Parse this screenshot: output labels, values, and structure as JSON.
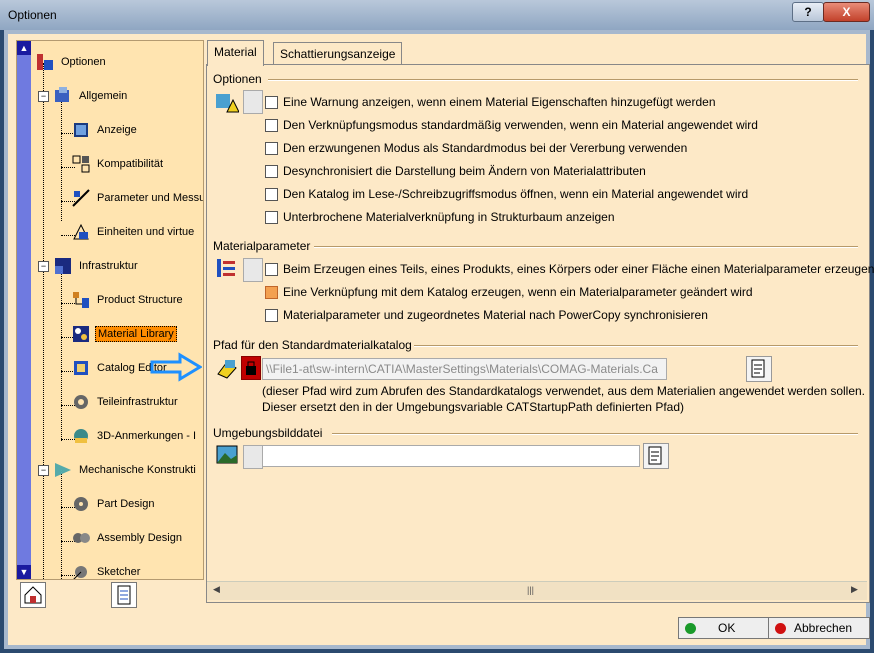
{
  "window": {
    "title": "Optionen",
    "help_label": "?",
    "close_label": "X"
  },
  "tree": {
    "items": [
      {
        "label": "Optionen",
        "icon": "options-icon"
      },
      {
        "label": "Allgemein",
        "icon": "general-icon"
      },
      {
        "label": "Anzeige",
        "icon": "display-icon"
      },
      {
        "label": "Kompatibilität",
        "icon": "compatibility-icon"
      },
      {
        "label": "Parameter und Messu",
        "icon": "parameters-icon"
      },
      {
        "label": "Einheiten und virtue",
        "icon": "units-icon"
      },
      {
        "label": "Infrastruktur",
        "icon": "infrastructure-icon"
      },
      {
        "label": "Product Structure",
        "icon": "product-structure-icon"
      },
      {
        "label": "Material Library",
        "icon": "material-library-icon"
      },
      {
        "label": "Catalog Editor",
        "icon": "catalog-editor-icon"
      },
      {
        "label": "Teileinfrastruktur",
        "icon": "gear-icon"
      },
      {
        "label": "3D-Anmerkungen - I",
        "icon": "annotation-icon"
      },
      {
        "label": "Mechanische Konstrukti",
        "icon": "mechanical-icon"
      },
      {
        "label": "Part Design",
        "icon": "part-design-icon"
      },
      {
        "label": "Assembly Design",
        "icon": "assembly-icon"
      },
      {
        "label": "Sketcher",
        "icon": "sketcher-icon"
      }
    ],
    "selected": "Material Library"
  },
  "tabs": [
    {
      "label": "Material",
      "active": true
    },
    {
      "label": "Schattierungsanzeige",
      "active": false
    }
  ],
  "options": {
    "title": "Optionen",
    "items": [
      {
        "label": "Eine Warnung anzeigen, wenn einem Material Eigenschaften hinzugefügt werden",
        "checked": false
      },
      {
        "label": "Den Verknüpfungsmodus standardmäßig verwenden, wenn ein Material angewendet wird",
        "checked": false
      },
      {
        "label": "Den erzwungenen Modus als Standardmodus bei der Vererbung verwenden",
        "checked": false
      },
      {
        "label": "Desynchronisiert die Darstellung beim Ändern von Materialattributen",
        "checked": false
      },
      {
        "label": "Den Katalog im Lese-/Schreibzugriffsmodus öffnen, wenn ein Material angewendet wird",
        "checked": false
      },
      {
        "label": "Unterbrochene Materialverknüpfung in Strukturbaum anzeigen",
        "checked": false
      }
    ]
  },
  "materialparameter": {
    "title": "Materialparameter",
    "items": [
      {
        "label": "Beim Erzeugen eines Teils, eines Produkts, eines Körpers oder einer Fläche einen Materialparameter erzeugen",
        "checked": false
      },
      {
        "label": "Eine Verknüpfung mit dem Katalog erzeugen, wenn ein Materialparameter geändert wird",
        "checked": "partial"
      },
      {
        "label": "Materialparameter und zugeordnetes Material nach PowerCopy synchronisieren",
        "checked": false
      }
    ]
  },
  "pfad": {
    "title": "Pfad für den Standardmaterialkatalog",
    "value": "\\\\File1-at\\sw-intern\\CATIA\\MasterSettings\\Materials\\COMAG-Materials.Ca",
    "note_line1": "(dieser Pfad wird zum Abrufen des Standardkatalogs verwendet, aus dem Materialien angewendet werden sollen.",
    "note_line2": "Dieser ersetzt den in der Umgebungsvariable CATStartupPath definierten Pfad)"
  },
  "umgebung": {
    "title": "Umgebungsbilddatei",
    "value": ""
  },
  "buttons": {
    "ok": "OK",
    "cancel": "Abbrechen"
  },
  "colors": {
    "selection": "#ff8c00",
    "background": "#fde9c7",
    "tree_bg": "#ffe4b0",
    "ok_dot": "#1a9a2a",
    "cancel_dot": "#d01010",
    "arrow": "#1e90ff"
  }
}
